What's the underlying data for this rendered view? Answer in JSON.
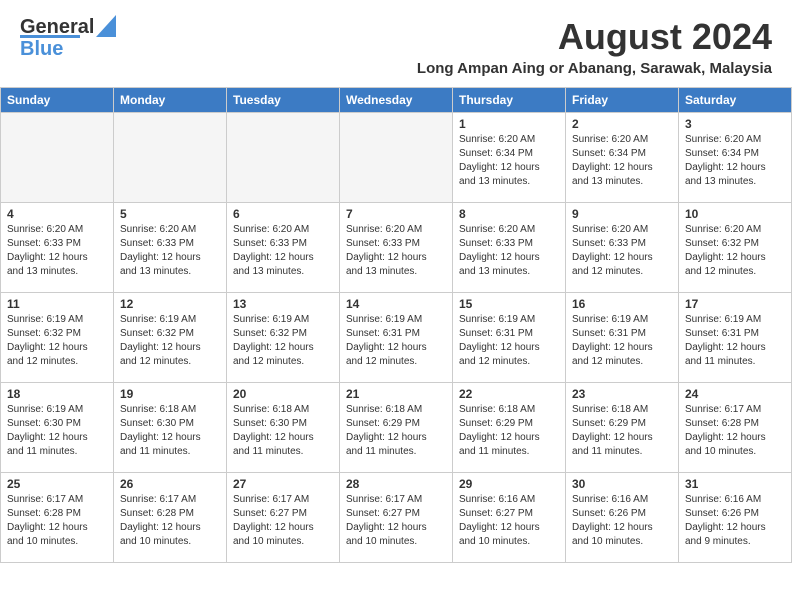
{
  "header": {
    "logo": {
      "line1": "General",
      "line2": "Blue"
    },
    "title": "August 2024",
    "location": "Long Ampan Aing or Abanang, Sarawak, Malaysia"
  },
  "weekdays": [
    "Sunday",
    "Monday",
    "Tuesday",
    "Wednesday",
    "Thursday",
    "Friday",
    "Saturday"
  ],
  "weeks": [
    [
      {
        "day": "",
        "empty": true
      },
      {
        "day": "",
        "empty": true
      },
      {
        "day": "",
        "empty": true
      },
      {
        "day": "",
        "empty": true
      },
      {
        "day": "1",
        "sunrise": "6:20 AM",
        "sunset": "6:34 PM",
        "daylight": "12 hours and 13 minutes."
      },
      {
        "day": "2",
        "sunrise": "6:20 AM",
        "sunset": "6:34 PM",
        "daylight": "12 hours and 13 minutes."
      },
      {
        "day": "3",
        "sunrise": "6:20 AM",
        "sunset": "6:34 PM",
        "daylight": "12 hours and 13 minutes."
      }
    ],
    [
      {
        "day": "4",
        "sunrise": "6:20 AM",
        "sunset": "6:33 PM",
        "daylight": "12 hours and 13 minutes."
      },
      {
        "day": "5",
        "sunrise": "6:20 AM",
        "sunset": "6:33 PM",
        "daylight": "12 hours and 13 minutes."
      },
      {
        "day": "6",
        "sunrise": "6:20 AM",
        "sunset": "6:33 PM",
        "daylight": "12 hours and 13 minutes."
      },
      {
        "day": "7",
        "sunrise": "6:20 AM",
        "sunset": "6:33 PM",
        "daylight": "12 hours and 13 minutes."
      },
      {
        "day": "8",
        "sunrise": "6:20 AM",
        "sunset": "6:33 PM",
        "daylight": "12 hours and 13 minutes."
      },
      {
        "day": "9",
        "sunrise": "6:20 AM",
        "sunset": "6:33 PM",
        "daylight": "12 hours and 12 minutes."
      },
      {
        "day": "10",
        "sunrise": "6:20 AM",
        "sunset": "6:32 PM",
        "daylight": "12 hours and 12 minutes."
      }
    ],
    [
      {
        "day": "11",
        "sunrise": "6:19 AM",
        "sunset": "6:32 PM",
        "daylight": "12 hours and 12 minutes."
      },
      {
        "day": "12",
        "sunrise": "6:19 AM",
        "sunset": "6:32 PM",
        "daylight": "12 hours and 12 minutes."
      },
      {
        "day": "13",
        "sunrise": "6:19 AM",
        "sunset": "6:32 PM",
        "daylight": "12 hours and 12 minutes."
      },
      {
        "day": "14",
        "sunrise": "6:19 AM",
        "sunset": "6:31 PM",
        "daylight": "12 hours and 12 minutes."
      },
      {
        "day": "15",
        "sunrise": "6:19 AM",
        "sunset": "6:31 PM",
        "daylight": "12 hours and 12 minutes."
      },
      {
        "day": "16",
        "sunrise": "6:19 AM",
        "sunset": "6:31 PM",
        "daylight": "12 hours and 12 minutes."
      },
      {
        "day": "17",
        "sunrise": "6:19 AM",
        "sunset": "6:31 PM",
        "daylight": "12 hours and 11 minutes."
      }
    ],
    [
      {
        "day": "18",
        "sunrise": "6:19 AM",
        "sunset": "6:30 PM",
        "daylight": "12 hours and 11 minutes."
      },
      {
        "day": "19",
        "sunrise": "6:18 AM",
        "sunset": "6:30 PM",
        "daylight": "12 hours and 11 minutes."
      },
      {
        "day": "20",
        "sunrise": "6:18 AM",
        "sunset": "6:30 PM",
        "daylight": "12 hours and 11 minutes."
      },
      {
        "day": "21",
        "sunrise": "6:18 AM",
        "sunset": "6:29 PM",
        "daylight": "12 hours and 11 minutes."
      },
      {
        "day": "22",
        "sunrise": "6:18 AM",
        "sunset": "6:29 PM",
        "daylight": "12 hours and 11 minutes."
      },
      {
        "day": "23",
        "sunrise": "6:18 AM",
        "sunset": "6:29 PM",
        "daylight": "12 hours and 11 minutes."
      },
      {
        "day": "24",
        "sunrise": "6:17 AM",
        "sunset": "6:28 PM",
        "daylight": "12 hours and 10 minutes."
      }
    ],
    [
      {
        "day": "25",
        "sunrise": "6:17 AM",
        "sunset": "6:28 PM",
        "daylight": "12 hours and 10 minutes."
      },
      {
        "day": "26",
        "sunrise": "6:17 AM",
        "sunset": "6:28 PM",
        "daylight": "12 hours and 10 minutes."
      },
      {
        "day": "27",
        "sunrise": "6:17 AM",
        "sunset": "6:27 PM",
        "daylight": "12 hours and 10 minutes."
      },
      {
        "day": "28",
        "sunrise": "6:17 AM",
        "sunset": "6:27 PM",
        "daylight": "12 hours and 10 minutes."
      },
      {
        "day": "29",
        "sunrise": "6:16 AM",
        "sunset": "6:27 PM",
        "daylight": "12 hours and 10 minutes."
      },
      {
        "day": "30",
        "sunrise": "6:16 AM",
        "sunset": "6:26 PM",
        "daylight": "12 hours and 10 minutes."
      },
      {
        "day": "31",
        "sunrise": "6:16 AM",
        "sunset": "6:26 PM",
        "daylight": "12 hours and 9 minutes."
      }
    ]
  ]
}
